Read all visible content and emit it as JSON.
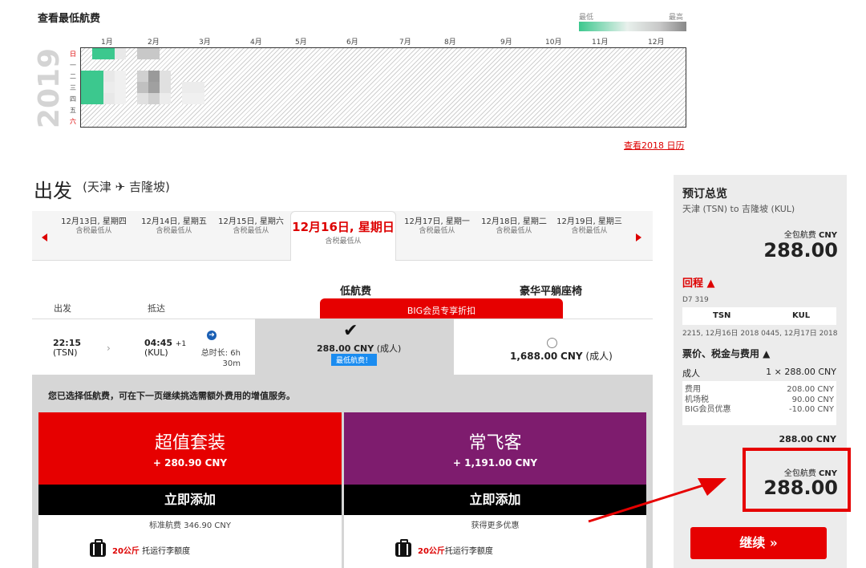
{
  "calendar": {
    "title": "查看最低航费",
    "legend_low": "最低",
    "legend_high": "最高",
    "year": "2019",
    "months": [
      "1月",
      "2月",
      "3月",
      "4月",
      "5月",
      "6月",
      "7月",
      "8月",
      "9月",
      "10月",
      "11月",
      "12月"
    ],
    "weekdays": [
      "日",
      "一",
      "二",
      "三",
      "四",
      "五",
      "六"
    ],
    "prev_link": "查看2018 日历",
    "colors": {
      "cheap": "#3cc88e",
      "mid": "#c8c8c8",
      "dark": "#9a9a9a"
    }
  },
  "departure": {
    "title": "出发",
    "route": "(天津 ✈ 吉隆坡)"
  },
  "date_tabs": [
    {
      "main": "12月13日, 星期四",
      "sub": "含税最低从"
    },
    {
      "main": "12月14日, 星期五",
      "sub": "含税最低从"
    },
    {
      "main": "12月15日, 星期六",
      "sub": "含税最低从"
    },
    {
      "main": "12月16日, 星期日",
      "sub": "含税最低从"
    },
    {
      "main": "12月17日, 星期一",
      "sub": "含税最低从"
    },
    {
      "main": "12月18日, 星期二",
      "sub": "含税最低从"
    },
    {
      "main": "12月19日, 星期三",
      "sub": "含税最低从"
    }
  ],
  "fare_columns": {
    "low": "低航费",
    "luxury": "豪华平躺座椅",
    "member_banner": "BIG会员专享折扣"
  },
  "table_headers": {
    "depart": "出发",
    "arrive": "抵达"
  },
  "flight": {
    "dep_time": "22:15",
    "dep_code": "(TSN)",
    "arr_time": "04:45",
    "arr_offset": "+1",
    "arr_code": "(KUL)",
    "duration_line1": "总时长: 6h",
    "duration_line2": "30m",
    "low_price": "288.00",
    "low_currency": "CNY",
    "low_unit": "(成人)",
    "low_tag": "最低航费！",
    "lux_price": "1,688.00",
    "lux_currency": "CNY",
    "lux_unit": "(成人)"
  },
  "notice": "您已选择低航费，可在下一页继续挑选需额外费用的增值服务。",
  "packages": [
    {
      "title": "超值套装",
      "price": "+ 280.90 CNY",
      "button": "立即添加",
      "sub": "标准航费 346.90 CNY",
      "bag_weight": "20公斤",
      "bag_text": " 托运行李额度"
    },
    {
      "title": "常飞客",
      "price": "+ 1,191.00 CNY",
      "button": "立即添加",
      "sub": "获得更多优惠",
      "bag_weight": "20公斤",
      "bag_text": "托运行李额度"
    }
  ],
  "sidebar": {
    "title": "预订总览",
    "route": "天津 (TSN) to 吉隆坡 (KUL)",
    "total_label": "全包航费",
    "total_currency": "CNY",
    "total": "288.00",
    "return_label": "回程 ▲",
    "flight_no": "D7 319",
    "from": "TSN",
    "to": "KUL",
    "dep_info": "2215, 12月16日 2018",
    "arr_info": "0445, 12月17日 2018",
    "fees_heading": "票价、税金与费用 ▲",
    "adult_label": "成人",
    "adult_value": "1 × 288.00 CNY",
    "fees": [
      {
        "label": "费用",
        "value": "208.00 CNY"
      },
      {
        "label": "机场税",
        "value": "90.00 CNY"
      },
      {
        "label": "BIG会员优惠",
        "value": "-10.00 CNY"
      }
    ],
    "subtotal": "288.00 CNY",
    "total2_label": "全包航费",
    "total2_currency": "CNY",
    "total2": "288.00",
    "continue": "继续 »"
  }
}
